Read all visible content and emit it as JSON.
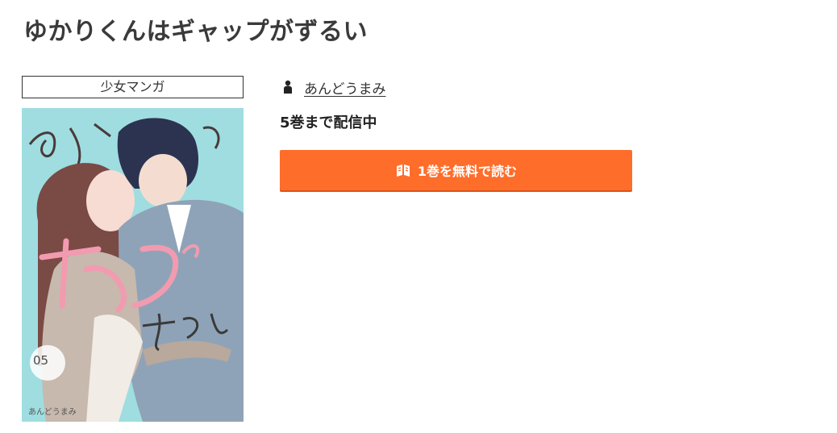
{
  "page": {
    "title": "ゆかりくんはギャップがずるい"
  },
  "genre": {
    "label": "少女マンガ"
  },
  "cover": {
    "volume_number": "05",
    "author_caption": "あんどうまみ",
    "colors": {
      "background": "#9fdde0",
      "hair_girl": "#7a4a45",
      "hair_boy": "#2c3350",
      "jacket": "#8fa3b8",
      "title_pink": "#f29bb0"
    }
  },
  "author": {
    "icon": "person-icon",
    "name": "あんどうまみ"
  },
  "availability": {
    "text": "5巻まで配信中"
  },
  "cta": {
    "icon": "open-book-icon",
    "label": "1巻を無料で読む",
    "color": "#ff6d2a"
  }
}
